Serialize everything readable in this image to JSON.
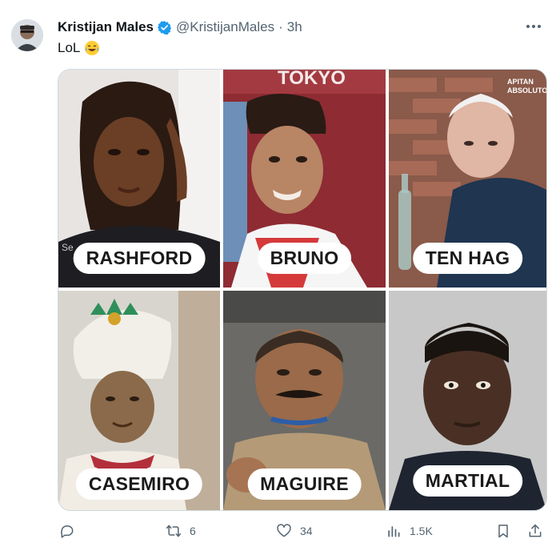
{
  "author": {
    "name": "Kristijan Males",
    "handle": "@KristijanMales",
    "time": "3h"
  },
  "tweet": {
    "text": "LoL",
    "emoji": "face-with-tears-of-joy"
  },
  "media": {
    "labels": [
      "RASHFORD",
      "BRUNO",
      "TEN HAG",
      "CASEMIRO",
      "MAGUIRE",
      "MARTIAL"
    ],
    "panel_texts": [
      "TOKYO",
      "APITAN",
      "ABSOLUTO"
    ]
  },
  "actions": {
    "reply": "",
    "retweet": "6",
    "like": "34",
    "views": "1.5K"
  },
  "colors": {
    "verified": "#1d9bf0",
    "text": "#0f1419",
    "secondary": "#536471",
    "border": "#cfd9de"
  }
}
